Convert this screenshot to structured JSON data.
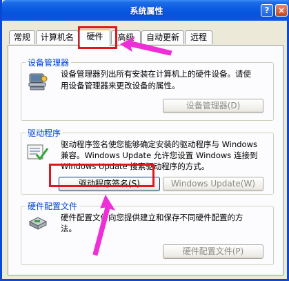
{
  "window": {
    "title": "系统属性",
    "help_label": "?",
    "close_label": "×"
  },
  "tabs": [
    {
      "label": "常规"
    },
    {
      "label": "计算机名"
    },
    {
      "label": "硬件"
    },
    {
      "label": "高级"
    },
    {
      "label": "自动更新"
    },
    {
      "label": "远程"
    }
  ],
  "device_manager": {
    "title": "设备管理器",
    "line1": "设备管理器列出所有安装在计算机上的硬件设备。请使",
    "line2": "用设备管理器来更改设备的属性。",
    "button": "设备管理器(D)"
  },
  "drivers": {
    "title": "驱动程序",
    "line1": "驱动程序签名使您能够确定安装的驱动程序与 Windows",
    "line2": "兼容。Windows Update 允许您设置 Windows 连接到",
    "line3": "Windows Update 搜索驱动程序的方式。",
    "signing_button": "驱动程序签名(S)",
    "update_button": "Windows Update(W)"
  },
  "hardware_profiles": {
    "title": "硬件配置文件",
    "line1": "硬件配置文件向您提供建立和保存不同硬件配置的方",
    "line2": "法。",
    "button": "硬件配置文件(P)"
  },
  "colors": {
    "title_bar": "#0a5ae2",
    "group_title": "#0046d5",
    "annotation": "#e0161b",
    "arrow": "#ee2fd8"
  }
}
